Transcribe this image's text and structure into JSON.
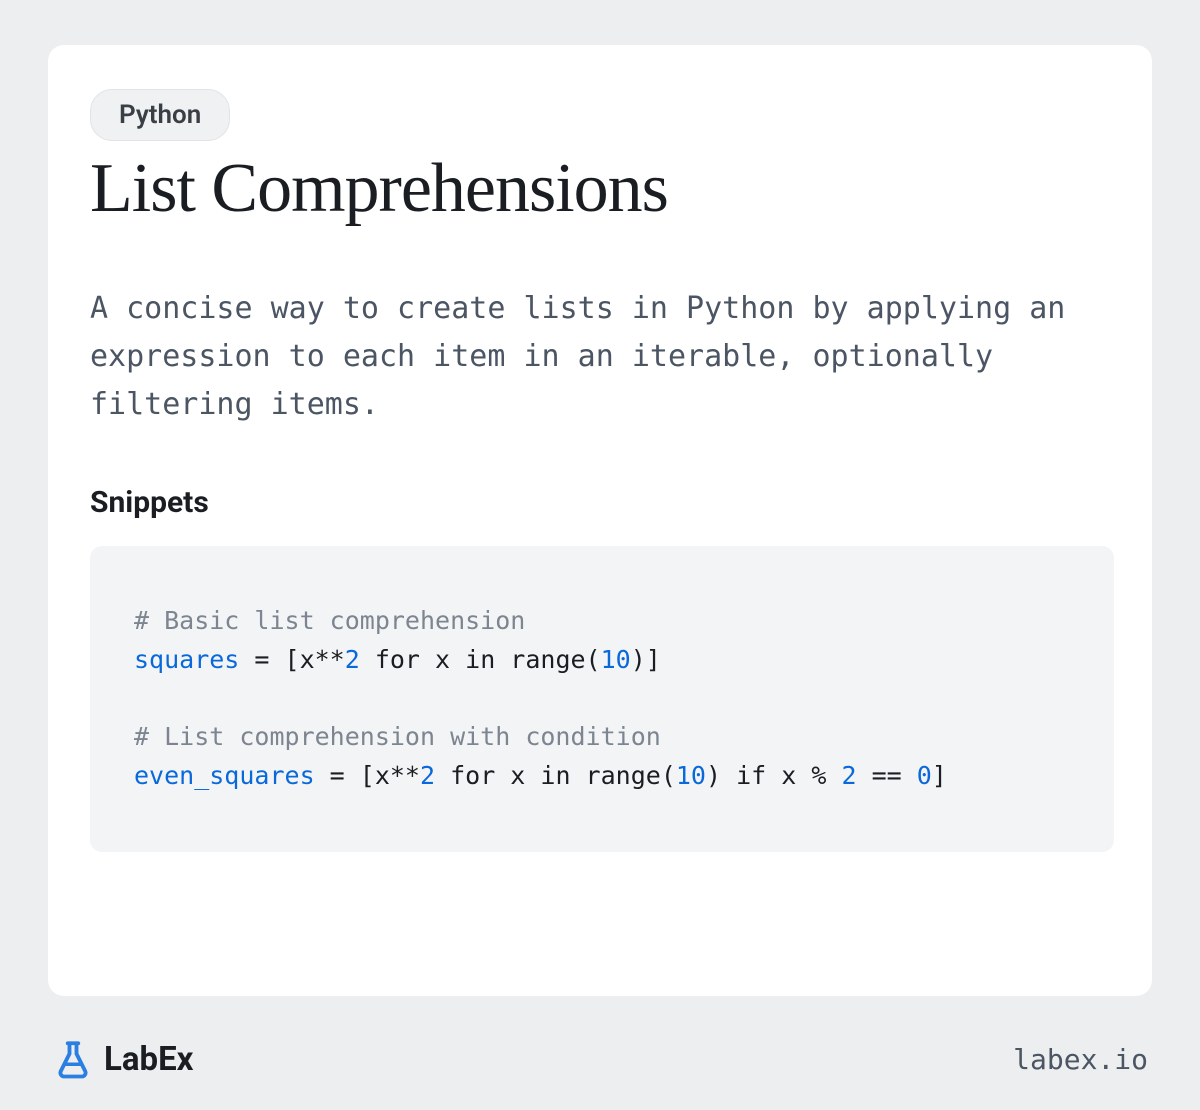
{
  "badge": "Python",
  "title": "List Comprehensions",
  "description": "A concise way to create lists in Python by applying an expression to each item in an iterable, optionally filtering items.",
  "section_heading": "Snippets",
  "code": {
    "line1_comment": "# Basic list comprehension",
    "line2_var": "squares",
    "line2_eq": " = [x**",
    "line2_num1": "2",
    "line2_for": " for x in range(",
    "line2_num2": "10",
    "line2_close": ")]",
    "line4_comment": "# List comprehension with condition",
    "line5_var": "even_squares",
    "line5_eq": " = [x**",
    "line5_num1": "2",
    "line5_for": " for x in range(",
    "line5_num2": "10",
    "line5_if": ") if x % ",
    "line5_num3": "2",
    "line5_eqeq": " == ",
    "line5_num4": "0",
    "line5_close": "]"
  },
  "logo_text": "LabEx",
  "site_url": "labex.io",
  "colors": {
    "page_bg": "#eceef0",
    "card_bg": "#ffffff",
    "code_bg": "#f3f4f6",
    "accent_blue": "#0969da",
    "text_primary": "#1a1d21",
    "text_secondary": "#4b5563",
    "comment_gray": "#7d8590"
  }
}
